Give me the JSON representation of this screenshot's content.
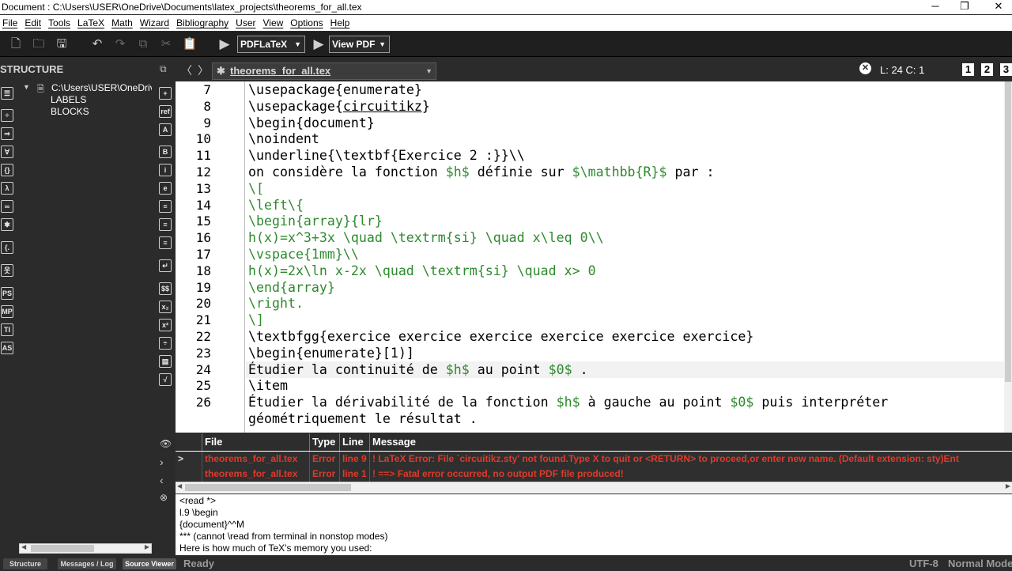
{
  "window": {
    "title": "Document : C:\\Users\\USER\\OneDrive\\Documents\\latex_projects\\theorems_for_all.tex",
    "minimize": "─",
    "restore": "❐",
    "close": "✕"
  },
  "menu": [
    "File",
    "Edit",
    "Tools",
    "LaTeX",
    "Math",
    "Wizard",
    "Bibliography",
    "User",
    "View",
    "Options",
    "Help"
  ],
  "toolbar": {
    "compiler": "PDFLaTeX",
    "viewer": "View PDF"
  },
  "structure": {
    "header": "STRUCTURE",
    "root": "C:\\Users\\USER\\OneDrive",
    "children": [
      "LABELS",
      "BLOCKS"
    ]
  },
  "editor": {
    "tab_label": "theorems_for_all.tex",
    "cursor_status": "L: 24 C: 1",
    "view_buttons": [
      "1",
      "2",
      "3"
    ],
    "line_numbers": [
      "7",
      "8",
      "9",
      "10",
      "11",
      "12",
      "13",
      "14",
      "15",
      "16",
      "17",
      "18",
      "19",
      "20",
      "21",
      "22",
      "23",
      "24",
      "25",
      "26"
    ],
    "lines": [
      {
        "n": "7",
        "parts": [
          [
            "kw",
            "\\usepackage"
          ],
          [
            "br",
            "{"
          ],
          [
            "arg",
            "enumerate"
          ],
          [
            "br",
            "}"
          ]
        ]
      },
      {
        "n": "8",
        "parts": [
          [
            "kw",
            "\\usepackage"
          ],
          [
            "br",
            "{"
          ],
          [
            "ul",
            "circuitikz"
          ],
          [
            "br",
            "}"
          ]
        ]
      },
      {
        "n": "9",
        "parts": [
          [
            "kw",
            "\\begin"
          ],
          [
            "br",
            "{"
          ],
          [
            "arg",
            "document"
          ],
          [
            "br",
            "}"
          ]
        ]
      },
      {
        "n": "10",
        "parts": [
          [
            "kw",
            "\\noindent"
          ]
        ]
      },
      {
        "n": "11",
        "parts": [
          [
            "kw",
            "\\underline"
          ],
          [
            "br",
            "{"
          ],
          [
            "kw",
            "\\textbf"
          ],
          [
            "br",
            "{"
          ],
          [
            "arg",
            "Exercice 2 :"
          ],
          [
            "br",
            "}}"
          ],
          [
            "kw",
            "\\\\"
          ]
        ]
      },
      {
        "n": "12",
        "parts": [
          [
            "txt",
            "on considère la fonction "
          ],
          [
            "math",
            "$h$"
          ],
          [
            "txt",
            " définie sur "
          ],
          [
            "math",
            "$\\mathbb{R}$"
          ],
          [
            "txt",
            " par :"
          ]
        ]
      },
      {
        "n": "13",
        "parts": [
          [
            "math",
            "\\["
          ]
        ]
      },
      {
        "n": "14",
        "parts": [
          [
            "math",
            "\\left\\{"
          ]
        ]
      },
      {
        "n": "15",
        "parts": [
          [
            "math",
            "\\begin{array}{lr}"
          ]
        ]
      },
      {
        "n": "16",
        "parts": [
          [
            "math",
            "h(x)=x^3+3x \\quad \\textrm{si} \\quad x\\leq 0\\\\"
          ]
        ]
      },
      {
        "n": "17",
        "parts": [
          [
            "math",
            "\\vspace{1mm}\\\\"
          ]
        ]
      },
      {
        "n": "18",
        "parts": [
          [
            "math",
            "h(x)=2x\\ln x-2x \\quad \\textrm{si} \\quad x> 0"
          ]
        ]
      },
      {
        "n": "19",
        "parts": [
          [
            "math",
            "\\end{array}"
          ]
        ]
      },
      {
        "n": "20",
        "parts": [
          [
            "math",
            "\\right."
          ]
        ]
      },
      {
        "n": "21",
        "parts": [
          [
            "math",
            "\\]"
          ]
        ]
      },
      {
        "n": "22",
        "parts": [
          [
            "kw",
            "\\textbfgg"
          ],
          [
            "br",
            "{"
          ],
          [
            "arg",
            "exercice exercice exercice exercice exercice exercice"
          ],
          [
            "br",
            "}"
          ]
        ]
      },
      {
        "n": "23",
        "parts": [
          [
            "kw",
            "\\begin"
          ],
          [
            "br",
            "{"
          ],
          [
            "arg",
            "enumerate"
          ],
          [
            "br",
            "}"
          ],
          [
            "txt",
            "[1)]"
          ]
        ]
      },
      {
        "n": "24",
        "parts": [
          [
            "txt",
            "Étudier la continuité de "
          ],
          [
            "math",
            "$h$"
          ],
          [
            "txt",
            " au point "
          ],
          [
            "math",
            "$0$"
          ],
          [
            "txt",
            " ."
          ]
        ]
      },
      {
        "n": "25",
        "parts": [
          [
            "kw",
            "\\item"
          ]
        ]
      },
      {
        "n": "26",
        "parts": [
          [
            "txt",
            "Étudier la dérivabilité de la fonction "
          ],
          [
            "math",
            "$h$"
          ],
          [
            "txt",
            " à gauche au point "
          ],
          [
            "math",
            "$0$"
          ],
          [
            "txt",
            " puis interpréter"
          ]
        ]
      },
      {
        "n": "",
        "parts": [
          [
            "txt",
            "géométriquement le résultat ."
          ]
        ]
      }
    ]
  },
  "messages": {
    "headers": [
      "File",
      "Type",
      "Line",
      "Message"
    ],
    "rows": [
      {
        "marker": ">",
        "file": "theorems_for_all.tex",
        "type": "Error",
        "line": "line 9",
        "message": "! LaTeX Error: File `circuitikz.sty' not found.Type X to quit or <RETURN> to proceed,or enter new name. (Default extension: sty)Ent"
      },
      {
        "marker": "",
        "file": "theorems_for_all.tex",
        "type": "Error",
        "line": "line 1",
        "message": "! ==> Fatal error occurred, no output PDF file produced!"
      }
    ]
  },
  "log": [
    "<read *>",
    "l.9 \\begin",
    "{document}^^M",
    "*** (cannot \\read from terminal in nonstop modes)",
    "Here is how much of TeX's memory you used:"
  ],
  "bottom_tabs": [
    "Structure",
    "Messages / Log",
    "Source Viewer"
  ],
  "statusbar": {
    "state": "Ready",
    "encoding": "UTF-8",
    "mode": "Normal Mode"
  }
}
